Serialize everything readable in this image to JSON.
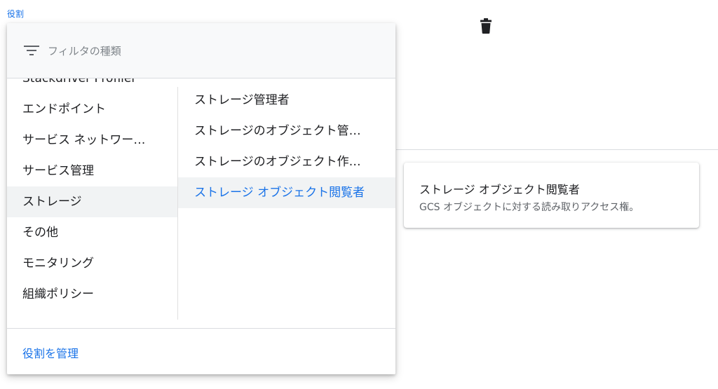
{
  "header": {
    "role_label": "役割"
  },
  "toolbar": {
    "delete_icon": "trash-icon"
  },
  "tooltip": {
    "title": "ストレージ オブジェクト閲覧者",
    "description": "GCS オブジェクトに対する読み取りアクセス権。"
  },
  "dropdown": {
    "filter_placeholder": "フィルタの種類",
    "filter_icon": "filter-icon",
    "categories": [
      "Stackdriver Profiler",
      "エンドポイント",
      "サービス ネットワー…",
      "サービス管理",
      "ストレージ",
      "その他",
      "モニタリング",
      "組織ポリシー"
    ],
    "selected_category": "ストレージ",
    "roles": [
      "ストレージ管理者",
      "ストレージのオブジェクト管…",
      "ストレージのオブジェクト作…",
      "ストレージ オブジェクト閲覧者"
    ],
    "selected_role": "ストレージ オブジェクト閲覧者",
    "manage_roles_label": "役割を管理"
  },
  "colors": {
    "accent": "#1a73e8",
    "selected_bg": "#f1f3f4",
    "divider": "#dadce0"
  }
}
